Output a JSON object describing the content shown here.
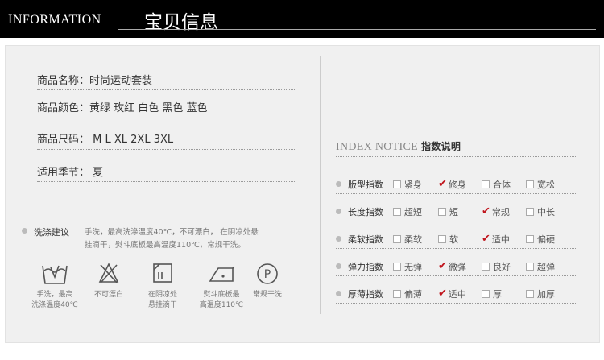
{
  "header": {
    "en": "INFORMATION",
    "cn": "宝贝信息"
  },
  "product": {
    "name": "商品名称：时尚运动套装",
    "color": "商品颜色：黄绿 玫红 白色 黑色 蓝色",
    "size": "商品尺码： M L XL 2XL 3XL",
    "season": "适用季节： 夏"
  },
  "index": {
    "title_en": "INDEX NOTICE",
    "title_cn": "指数说明",
    "rows": [
      {
        "label": "版型指数",
        "options": [
          "紧身",
          "修身",
          "合体",
          "宽松"
        ],
        "checked": 1
      },
      {
        "label": "长度指数",
        "options": [
          "超短",
          "短",
          "常规",
          "中长"
        ],
        "checked": 2
      },
      {
        "label": "柔软指数",
        "options": [
          "柔软",
          "软",
          "适中",
          "偏硬"
        ],
        "checked": 2
      },
      {
        "label": "弹力指数",
        "options": [
          "无弹",
          "微弹",
          "良好",
          "超弹"
        ],
        "checked": 1
      },
      {
        "label": "厚薄指数",
        "options": [
          "偏薄",
          "适中",
          "厚",
          "加厚"
        ],
        "checked": 1
      }
    ]
  },
  "wash": {
    "label": "洗涤建议",
    "line1": "手洗，最高洗涤温度40℃，不可漂白， 在阴凉处悬",
    "line2": "挂滴干，熨斗底板最高温度110℃，常规干洗。",
    "icons": [
      {
        "name": "hand-wash-icon",
        "cap1": "手洗，最高",
        "cap2": "洗涤温度40℃"
      },
      {
        "name": "no-bleach-icon",
        "cap1": "不可漂白",
        "cap2": ""
      },
      {
        "name": "shade-dry-icon",
        "cap1": "在阴凉处",
        "cap2": "悬挂滴干"
      },
      {
        "name": "iron-icon",
        "cap1": "熨斗底板最",
        "cap2": "高温度110℃"
      },
      {
        "name": "dry-clean-icon",
        "cap1": "常规干洗",
        "cap2": ""
      }
    ]
  }
}
